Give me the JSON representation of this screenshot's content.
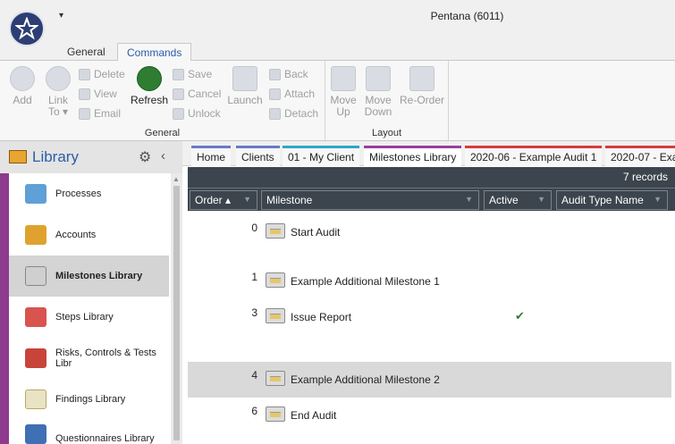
{
  "window": {
    "title": "Pentana (6011)",
    "quick_access": "▾"
  },
  "ribbon_tabs": [
    {
      "label": "General"
    },
    {
      "label": "Commands"
    }
  ],
  "ribbon": {
    "general": {
      "label": "General",
      "add": "Add",
      "link_to_1": "Link",
      "link_to_2": "To ▾",
      "delete": "Delete",
      "view": "View",
      "email": "Email",
      "refresh": "Refresh",
      "save": "Save",
      "cancel": "Cancel",
      "unlock": "Unlock",
      "launch": "Launch",
      "back": "Back",
      "attach": "Attach",
      "detach": "Detach"
    },
    "layout": {
      "label": "Layout",
      "move_up_1": "Move",
      "move_up_2": "Up",
      "move_down_1": "Move",
      "move_down_2": "Down",
      "reorder": "Re-Order"
    }
  },
  "sidebar": {
    "title": "Library",
    "items": [
      {
        "label": "Processes"
      },
      {
        "label": "Accounts"
      },
      {
        "label": "Milestones Library"
      },
      {
        "label": "Steps Library"
      },
      {
        "label": "Risks, Controls & Tests Libr"
      },
      {
        "label": "Findings Library"
      },
      {
        "label": "Questionnaires Library"
      }
    ]
  },
  "doc_tabs": [
    {
      "label": "Home",
      "color": "#6b78c9"
    },
    {
      "label": "Clients",
      "color": "#6b78c9"
    },
    {
      "label": "01 - My Client",
      "color": "#2aa8c2"
    },
    {
      "label": "Milestones Library",
      "color": "#9a3d9e"
    },
    {
      "label": "2020-06 - Example Audit 1",
      "color": "#d93a3a"
    },
    {
      "label": "2020-07 - Exa",
      "color": "#d93a3a"
    }
  ],
  "grid": {
    "records": "7 records",
    "columns": [
      {
        "label": "Order ▴"
      },
      {
        "label": "Milestone"
      },
      {
        "label": "Active"
      },
      {
        "label": "Audit Type Name"
      }
    ],
    "rows": [
      {
        "order": "0",
        "milestone": "Start Audit",
        "active": ""
      },
      {
        "order": "1",
        "milestone": "Example Additional Milestone 1",
        "active": ""
      },
      {
        "order": "3",
        "milestone": "Issue Report",
        "active": "✔"
      },
      {
        "order": "4",
        "milestone": "Example Additional Milestone 2",
        "active": ""
      },
      {
        "order": "6",
        "milestone": "End Audit",
        "active": ""
      }
    ]
  }
}
